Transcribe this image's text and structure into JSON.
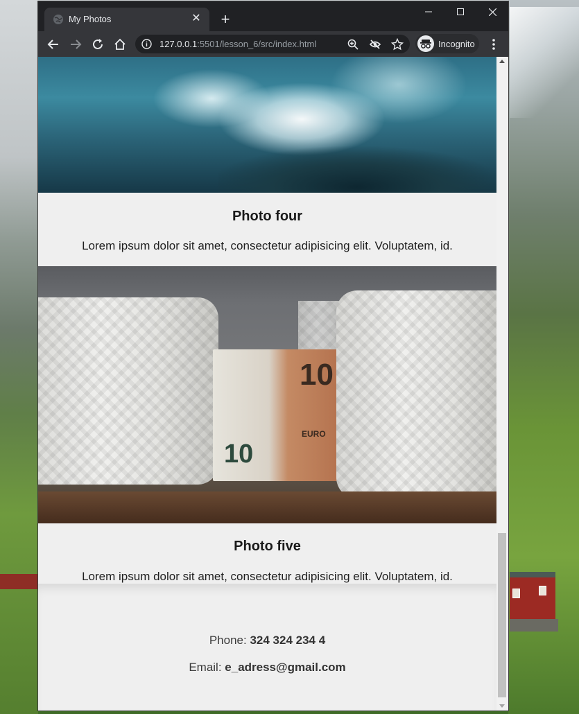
{
  "browser": {
    "tab_title": "My Photos",
    "url_host": "127.0.0.1",
    "url_rest": ":5501/lesson_6/src/index.html",
    "incognito_label": "Incognito"
  },
  "page": {
    "photos": [
      {
        "title": "Photo four",
        "text": "Lorem ipsum dolor sit amet, consectetur adipisicing elit. Voluptatem, id."
      },
      {
        "title": "Photo five",
        "text": "Lorem ipsum dolor sit amet, consectetur adipisicing elit. Voluptatem, id."
      }
    ],
    "footer": {
      "phone_label": "Phone:",
      "phone_value": "324 324 234 4",
      "email_label": "Email:",
      "email_value": "e_adress@gmail.com"
    }
  },
  "icons": [
    "globe-favicon-icon",
    "close-icon",
    "plus-icon",
    "minimize-icon",
    "maximize-icon",
    "window-close-icon",
    "back-arrow-icon",
    "forward-arrow-icon",
    "reload-icon",
    "home-icon",
    "info-icon",
    "zoom-icon",
    "eye-slash-icon",
    "star-icon",
    "incognito-icon",
    "kebab-menu-icon"
  ]
}
